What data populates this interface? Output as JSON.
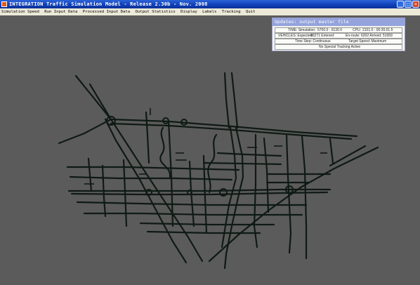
{
  "window": {
    "title": "INTEGRATION Traffic Simulation Model - Release 2.30b - Nov. 2008",
    "controls": {
      "minimize": "_",
      "maximize": "□",
      "close": "×"
    }
  },
  "menu": {
    "items": [
      "Simulation Speed",
      "Run Input Data",
      "Processed Input Data",
      "Output Statistics",
      "Display",
      "Labels",
      "Tracking",
      "Quit"
    ]
  },
  "status_panel": {
    "title": "Updates: output master file",
    "time_label": "TIME: Simulation:",
    "time_value": "5700.0 - 9130.0",
    "cpu_label": "CPU:",
    "cpu_value": "2101.0 - 00:35:01.5",
    "vehicles_label": "VEHICLES: Expected:",
    "vehicles_expected": "90271 Entered:",
    "enroute_label": "En-route:",
    "enroute_value": "6202 Arrived: 51959",
    "timestep_label": "Time Step: Continuous",
    "target_speed": "Target Speed: Maximum",
    "tracking": "No Special Tracking Active"
  },
  "colors": {
    "canvas_background": "#5b5b5b",
    "road": "#0f1a14",
    "titlebar": "#0f3fb6",
    "menubar": "#ece9d8",
    "panel_title": "#94a3dc",
    "close_button": "#d6452a"
  }
}
